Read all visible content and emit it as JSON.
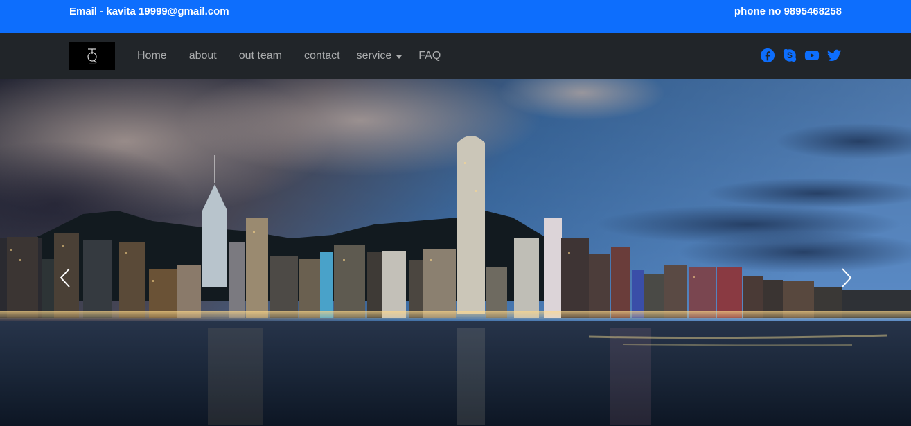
{
  "topbar": {
    "email": "Email - kavita 19999@gmail.com",
    "phone": "phone no 9895468258"
  },
  "navbar": {
    "links": [
      "Home",
      "about",
      "out team",
      "contact",
      "service",
      "FAQ"
    ],
    "social_icons": [
      "facebook-icon",
      "skype-icon",
      "youtube-icon",
      "twitter-icon"
    ],
    "accent_color": "#0d6efd",
    "bg_color": "#212529"
  },
  "hero": {
    "image": "city-skyline-night",
    "controls": [
      "prev-arrow",
      "next-arrow"
    ]
  }
}
